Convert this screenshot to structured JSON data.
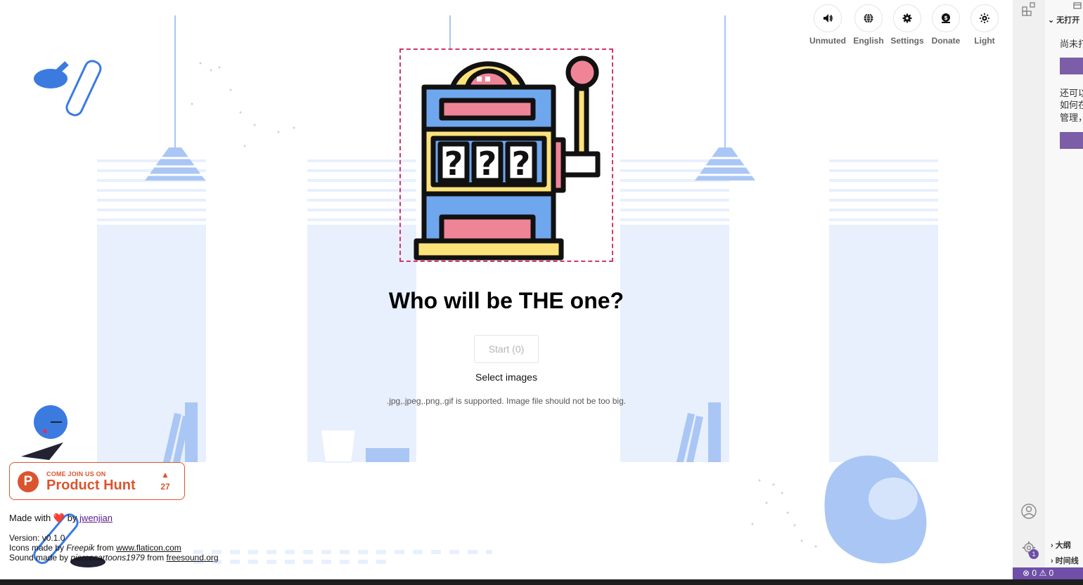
{
  "toolbar": {
    "buttons": [
      {
        "id": "sound",
        "label": "Unmuted",
        "icon": "speaker-icon"
      },
      {
        "id": "language",
        "label": "English",
        "icon": "globe-icon"
      },
      {
        "id": "settings",
        "label": "Settings",
        "icon": "gear-icon"
      },
      {
        "id": "donate",
        "label": "Donate",
        "icon": "money-icon"
      },
      {
        "id": "theme",
        "label": "Light",
        "icon": "sun-icon"
      }
    ]
  },
  "main": {
    "headline": "Who will be THE one?",
    "start_label": "Start (0)",
    "select_images_label": "Select images",
    "support_note": ".jpg,.jpeg,.png,.gif is supported. Image file should not be too big.",
    "slot_icon": "slot-machine-icon"
  },
  "product_hunt": {
    "small_text": "COME JOIN US ON",
    "big_text": "Product Hunt",
    "logo_letter": "P",
    "arrow": "▲",
    "count": "27"
  },
  "footer": {
    "made_with": "Made with",
    "heart_icon": "heart-icon",
    "by": "by",
    "author": "jwenjian",
    "version": "Version: v0.1.0",
    "icons_prefix": "Icons made by",
    "icons_author": "Freepik",
    "icons_from": "from",
    "icons_site": "www.flaticon.com",
    "sound_prefix": "Sound made by",
    "sound_author": "piercecartoons1979",
    "sound_from": "from",
    "sound_site": "freesound.org"
  },
  "ide": {
    "section_open": "无打开",
    "text_1": "尚未打",
    "text_2": "还可以",
    "text_3": "如何在",
    "text_4": "管理，",
    "outline": "大纲",
    "timeline": "时间线",
    "settings_badge": "1",
    "status_errors": "0",
    "status_warnings": "0",
    "accent": "#7b5ea7"
  },
  "colors": {
    "accent_dashed": "#d6336c",
    "product_hunt": "#da552f",
    "background_blue": "#e8f0fe"
  }
}
